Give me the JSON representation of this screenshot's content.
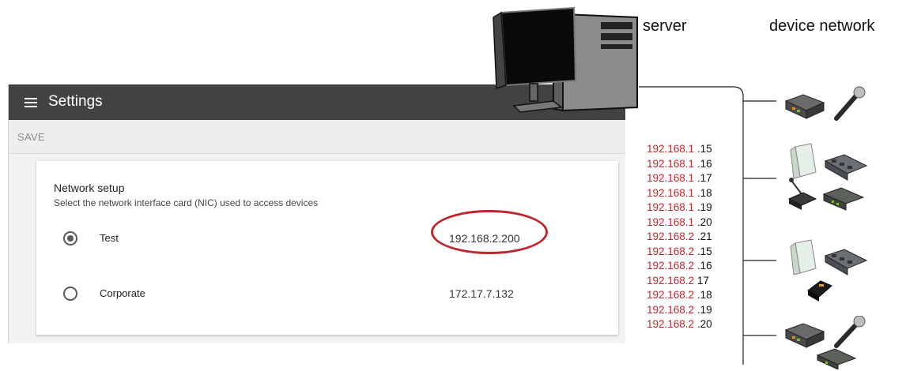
{
  "window": {
    "title": "Settings",
    "save_label": "SAVE"
  },
  "network_setup": {
    "heading": "Network setup",
    "description": "Select the network interface card (NIC) used to access devices",
    "options": [
      {
        "label": "Test",
        "ip": "192.168.2.200",
        "selected": true
      },
      {
        "label": "Corporate",
        "ip": "172.17.7.132",
        "selected": false
      }
    ]
  },
  "diagram": {
    "server_label": "server",
    "network_label": "device network",
    "ip_list": [
      {
        "prefix": "192.168.1",
        "suffix": " .15"
      },
      {
        "prefix": "192.168.1",
        "suffix": " .16"
      },
      {
        "prefix": "192.168.1",
        "suffix": " .17"
      },
      {
        "prefix": "192.168.1",
        "suffix": " .18"
      },
      {
        "prefix": "192.168.1",
        "suffix": " .19"
      },
      {
        "prefix": "192.168.1",
        "suffix": " .20"
      },
      {
        "prefix": "192.168.2",
        "suffix": " .21"
      },
      {
        "prefix": "192.168.2",
        "suffix": " .15"
      },
      {
        "prefix": "192.168.2",
        "suffix": " .16"
      },
      {
        "prefix": "192.168.2",
        "suffix": " 17"
      },
      {
        "prefix": "192.168.2",
        "suffix": " .18"
      },
      {
        "prefix": "192.168.2",
        "suffix": " .19"
      },
      {
        "prefix": "192.168.2",
        "suffix": " .20"
      }
    ]
  },
  "colors": {
    "titlebar": "#424242",
    "highlight_ring": "#c0262d",
    "ip_prefix": "#c0262d"
  },
  "icons": [
    "menu-icon",
    "radio-selected-icon",
    "radio-unselected-icon",
    "computer-icon",
    "receiver-icon",
    "microphone-icon",
    "access-point-icon",
    "charger-icon",
    "conference-mic-icon",
    "interface-box-icon",
    "bodypack-icon"
  ]
}
